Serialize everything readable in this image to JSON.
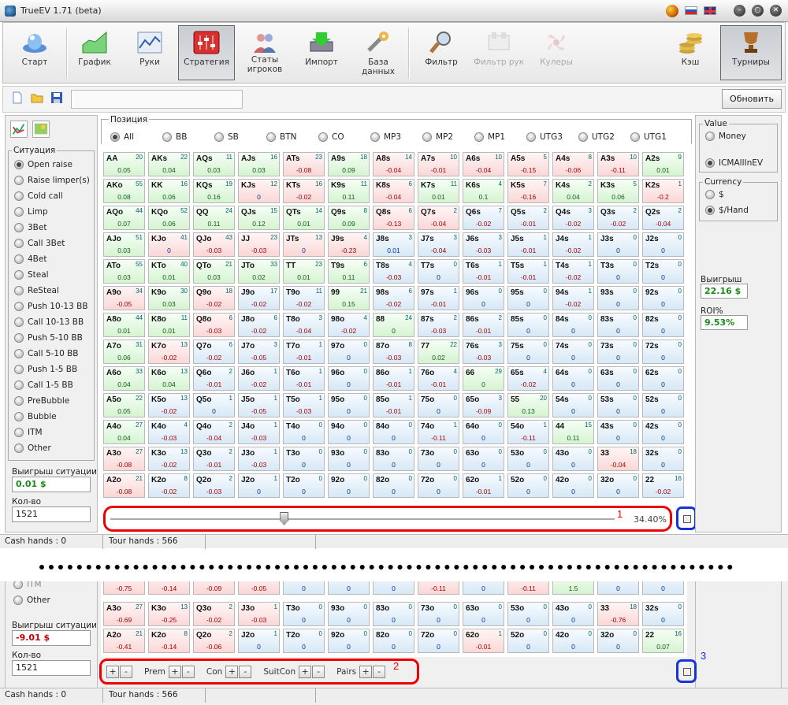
{
  "window": {
    "title": "TrueEV 1.71 (beta)"
  },
  "toolbar": {
    "items": [
      {
        "label": "Старт",
        "icon": "start-icon"
      },
      {
        "label": "График",
        "icon": "graph-icon"
      },
      {
        "label": "Руки",
        "icon": "hands-icon"
      },
      {
        "label": "Стратегия",
        "icon": "strategy-icon",
        "active": true
      },
      {
        "label": "Статы игроков",
        "icon": "players-stats-icon"
      },
      {
        "label": "Импорт",
        "icon": "import-icon"
      },
      {
        "label": "База данных",
        "icon": "database-icon"
      },
      {
        "label": "Фильтр",
        "icon": "filter-icon"
      },
      {
        "label": "Фильтр рук",
        "icon": "hand-filter-icon",
        "disabled": true
      },
      {
        "label": "Кулеры",
        "icon": "coolers-icon",
        "disabled": true
      },
      {
        "label": "Кэш",
        "icon": "cash-icon"
      },
      {
        "label": "Турниры",
        "icon": "tournaments-icon",
        "active": true
      }
    ],
    "update_label": "Обновить"
  },
  "position": {
    "legend": "Позиция",
    "options": [
      "All",
      "BB",
      "SB",
      "BTN",
      "CO",
      "MP3",
      "MP2",
      "MP1",
      "UTG3",
      "UTG2",
      "UTG1"
    ],
    "selected": "All"
  },
  "situation": {
    "legend": "Ситуация",
    "options": [
      "Open raise",
      "Raise limper(s)",
      "Cold call",
      "Limp",
      "3Bet",
      "Call 3Bet",
      "4Bet",
      "Steal",
      "ReSteal",
      "Push 10-13 BB",
      "Call 10-13 BB",
      "Push 5-10 BB",
      "Call 5-10 BB",
      "Push 1-5 BB",
      "Call 1-5 BB",
      "PreBubble",
      "Bubble",
      "ITM",
      "Other"
    ],
    "selected": "Open raise",
    "win_label": "Выигрыш ситуации",
    "win_value": "0.01 $",
    "count_label": "Кол-во",
    "count_value": "1521"
  },
  "value": {
    "legend": "Value",
    "options": [
      "Money",
      "ICMAllInEV"
    ],
    "selected": "ICMAllInEV"
  },
  "currency": {
    "legend": "Currency",
    "options": [
      "$",
      "$/Hand"
    ],
    "selected": "$/Hand"
  },
  "stats": {
    "win_label": "Выигрыш",
    "win_value": "22.16 $",
    "roi_label": "ROI%",
    "roi_value": "9.53%"
  },
  "slider": {
    "percent_label": "34.40%",
    "value_percent": 34.4
  },
  "status": {
    "cash": "Cash hands : 0",
    "tour": "Tour hands : 566"
  },
  "annotations": {
    "one": "1",
    "two": "2",
    "three": "3"
  },
  "bottom": {
    "win_value": "-9.01 $",
    "win_label": "Выигрыш ситуации",
    "count_label": "Кол-во",
    "count_value": "1521",
    "other_label": "Other",
    "itm_label": "ITM",
    "status_cash": "Cash hands : 0",
    "status_tour": "Tour hands : 566",
    "filters": [
      {
        "label": "Prem"
      },
      {
        "label": "Con"
      },
      {
        "label": "SuitCon"
      },
      {
        "label": "Pairs"
      }
    ],
    "plus": "+",
    "minus": "-",
    "top_values": [
      "-0.75",
      "-0.14",
      "-0.09",
      "-0.05",
      "0",
      "0",
      "0",
      "-0.11",
      "0",
      "-0.11",
      "1.5",
      "0",
      "0"
    ],
    "rows": [
      [
        [
          "A3o",
          "27",
          "-0.69",
          "r"
        ],
        [
          "K3o",
          "13",
          "-0.25",
          "r"
        ],
        [
          "Q3o",
          "2",
          "-0.02",
          "r"
        ],
        [
          "J3o",
          "1",
          "-0.03",
          "r"
        ],
        [
          "T3o",
          "0",
          "0",
          "b"
        ],
        [
          "93o",
          "0",
          "0",
          "b"
        ],
        [
          "83o",
          "0",
          "0",
          "b"
        ],
        [
          "73o",
          "0",
          "0",
          "b"
        ],
        [
          "63o",
          "0",
          "0",
          "b"
        ],
        [
          "53o",
          "0",
          "0",
          "b"
        ],
        [
          "43o",
          "0",
          "0",
          "b"
        ],
        [
          "33",
          "18",
          "-0.76",
          "r"
        ],
        [
          "32s",
          "0",
          "0",
          "b"
        ]
      ],
      [
        [
          "A2o",
          "21",
          "-0.41",
          "r"
        ],
        [
          "K2o",
          "8",
          "-0.14",
          "r"
        ],
        [
          "Q2o",
          "2",
          "-0.06",
          "r"
        ],
        [
          "J2o",
          "1",
          "0",
          "b"
        ],
        [
          "T2o",
          "0",
          "0",
          "b"
        ],
        [
          "92o",
          "0",
          "0",
          "b"
        ],
        [
          "82o",
          "0",
          "0",
          "b"
        ],
        [
          "72o",
          "0",
          "0",
          "b"
        ],
        [
          "62o",
          "1",
          "-0.01",
          "r"
        ],
        [
          "52o",
          "0",
          "0",
          "b"
        ],
        [
          "42o",
          "0",
          "0",
          "b"
        ],
        [
          "32o",
          "0",
          "0",
          "b"
        ],
        [
          "22",
          "16",
          "0.07",
          "g"
        ]
      ]
    ]
  },
  "grid": [
    [
      [
        "AA",
        "20",
        "0.05",
        "g"
      ],
      [
        "AKs",
        "22",
        "0.04",
        "g"
      ],
      [
        "AQs",
        "11",
        "0.03",
        "g"
      ],
      [
        "AJs",
        "16",
        "0.03",
        "g"
      ],
      [
        "ATs",
        "23",
        "-0.08",
        "r"
      ],
      [
        "A9s",
        "18",
        "0.09",
        "g"
      ],
      [
        "A8s",
        "14",
        "-0.04",
        "r"
      ],
      [
        "A7s",
        "10",
        "-0.01",
        "r"
      ],
      [
        "A6s",
        "10",
        "-0.04",
        "r"
      ],
      [
        "A5s",
        "5",
        "-0.15",
        "r"
      ],
      [
        "A4s",
        "8",
        "-0.06",
        "r"
      ],
      [
        "A3s",
        "10",
        "-0.11",
        "r"
      ],
      [
        "A2s",
        "9",
        "0.01",
        "g"
      ]
    ],
    [
      [
        "AKo",
        "55",
        "0.08",
        "g"
      ],
      [
        "KK",
        "16",
        "0.06",
        "g"
      ],
      [
        "KQs",
        "19",
        "0.16",
        "g"
      ],
      [
        "KJs",
        "12",
        "0",
        "r"
      ],
      [
        "KTs",
        "16",
        "-0.02",
        "r"
      ],
      [
        "K9s",
        "11",
        "0.11",
        "g"
      ],
      [
        "K8s",
        "6",
        "-0.04",
        "r"
      ],
      [
        "K7s",
        "11",
        "0.01",
        "g"
      ],
      [
        "K6s",
        "4",
        "0.1",
        "g"
      ],
      [
        "K5s",
        "7",
        "-0.16",
        "r"
      ],
      [
        "K4s",
        "2",
        "0.04",
        "g"
      ],
      [
        "K3s",
        "5",
        "0.06",
        "g"
      ],
      [
        "K2s",
        "1",
        "-0.2",
        "r"
      ]
    ],
    [
      [
        "AQo",
        "44",
        "0.07",
        "g"
      ],
      [
        "KQo",
        "52",
        "0.06",
        "g"
      ],
      [
        "QQ",
        "24",
        "0.11",
        "g"
      ],
      [
        "QJs",
        "15",
        "0.12",
        "g"
      ],
      [
        "QTs",
        "14",
        "0.01",
        "g"
      ],
      [
        "Q9s",
        "8",
        "0.09",
        "g"
      ],
      [
        "Q8s",
        "6",
        "-0.13",
        "r"
      ],
      [
        "Q7s",
        "2",
        "-0.04",
        "r"
      ],
      [
        "Q6s",
        "7",
        "-0.02",
        "b"
      ],
      [
        "Q5s",
        "2",
        "-0.01",
        "b"
      ],
      [
        "Q4s",
        "3",
        "-0.02",
        "b"
      ],
      [
        "Q3s",
        "2",
        "-0.02",
        "b"
      ],
      [
        "Q2s",
        "2",
        "-0.04",
        "b"
      ]
    ],
    [
      [
        "AJo",
        "51",
        "0.03",
        "g"
      ],
      [
        "KJo",
        "41",
        "0",
        "r"
      ],
      [
        "QJo",
        "43",
        "-0.03",
        "r"
      ],
      [
        "JJ",
        "23",
        "-0.03",
        "r"
      ],
      [
        "JTs",
        "13",
        "0",
        "r"
      ],
      [
        "J9s",
        "4",
        "-0.23",
        "r"
      ],
      [
        "J8s",
        "3",
        "0.01",
        "b"
      ],
      [
        "J7s",
        "3",
        "-0.04",
        "b"
      ],
      [
        "J6s",
        "3",
        "-0.03",
        "b"
      ],
      [
        "J5s",
        "1",
        "-0.01",
        "b"
      ],
      [
        "J4s",
        "1",
        "-0.02",
        "b"
      ],
      [
        "J3s",
        "0",
        "0",
        "b"
      ],
      [
        "J2s",
        "0",
        "0",
        "b"
      ]
    ],
    [
      [
        "ATo",
        "55",
        "0.03",
        "g"
      ],
      [
        "KTo",
        "40",
        "0.01",
        "g"
      ],
      [
        "QTo",
        "21",
        "0.03",
        "g"
      ],
      [
        "JTo",
        "33",
        "0.02",
        "g"
      ],
      [
        "TT",
        "23",
        "0.01",
        "g"
      ],
      [
        "T9s",
        "6",
        "0.11",
        "g"
      ],
      [
        "T8s",
        "4",
        "-0.03",
        "b"
      ],
      [
        "T7s",
        "0",
        "0",
        "b"
      ],
      [
        "T6s",
        "1",
        "-0.01",
        "b"
      ],
      [
        "T5s",
        "1",
        "-0.01",
        "b"
      ],
      [
        "T4s",
        "1",
        "-0.02",
        "b"
      ],
      [
        "T3s",
        "0",
        "0",
        "b"
      ],
      [
        "T2s",
        "0",
        "0",
        "b"
      ]
    ],
    [
      [
        "A9o",
        "34",
        "-0.05",
        "r"
      ],
      [
        "K9o",
        "30",
        "0.03",
        "g"
      ],
      [
        "Q9o",
        "18",
        "-0.02",
        "r"
      ],
      [
        "J9o",
        "17",
        "-0.02",
        "b"
      ],
      [
        "T9o",
        "11",
        "-0.02",
        "b"
      ],
      [
        "99",
        "21",
        "0.15",
        "g"
      ],
      [
        "98s",
        "6",
        "-0.02",
        "b"
      ],
      [
        "97s",
        "1",
        "-0.01",
        "b"
      ],
      [
        "96s",
        "0",
        "0",
        "b"
      ],
      [
        "95s",
        "0",
        "0",
        "b"
      ],
      [
        "94s",
        "1",
        "-0.02",
        "b"
      ],
      [
        "93s",
        "0",
        "0",
        "b"
      ],
      [
        "92s",
        "0",
        "0",
        "b"
      ]
    ],
    [
      [
        "A8o",
        "44",
        "0.01",
        "g"
      ],
      [
        "K8o",
        "11",
        "0.01",
        "g"
      ],
      [
        "Q8o",
        "6",
        "-0.03",
        "r"
      ],
      [
        "J8o",
        "6",
        "-0.02",
        "b"
      ],
      [
        "T8o",
        "3",
        "-0.04",
        "b"
      ],
      [
        "98o",
        "4",
        "-0.02",
        "b"
      ],
      [
        "88",
        "24",
        "0",
        "g"
      ],
      [
        "87s",
        "2",
        "-0.03",
        "b"
      ],
      [
        "86s",
        "2",
        "-0.01",
        "b"
      ],
      [
        "85s",
        "0",
        "0",
        "b"
      ],
      [
        "84s",
        "0",
        "0",
        "b"
      ],
      [
        "83s",
        "0",
        "0",
        "b"
      ],
      [
        "82s",
        "0",
        "0",
        "b"
      ]
    ],
    [
      [
        "A7o",
        "31",
        "0.06",
        "g"
      ],
      [
        "K7o",
        "13",
        "-0.02",
        "r"
      ],
      [
        "Q7o",
        "6",
        "-0.02",
        "b"
      ],
      [
        "J7o",
        "3",
        "-0.05",
        "b"
      ],
      [
        "T7o",
        "1",
        "-0.01",
        "b"
      ],
      [
        "97o",
        "0",
        "0",
        "b"
      ],
      [
        "87o",
        "8",
        "-0.03",
        "b"
      ],
      [
        "77",
        "22",
        "0.02",
        "g"
      ],
      [
        "76s",
        "3",
        "-0.03",
        "b"
      ],
      [
        "75s",
        "0",
        "0",
        "b"
      ],
      [
        "74s",
        "0",
        "0",
        "b"
      ],
      [
        "73s",
        "0",
        "0",
        "b"
      ],
      [
        "72s",
        "0",
        "0",
        "b"
      ]
    ],
    [
      [
        "A6o",
        "33",
        "0.04",
        "g"
      ],
      [
        "K6o",
        "13",
        "0.04",
        "g"
      ],
      [
        "Q6o",
        "2",
        "-0.01",
        "b"
      ],
      [
        "J6o",
        "1",
        "-0.02",
        "b"
      ],
      [
        "T6o",
        "1",
        "-0.01",
        "b"
      ],
      [
        "96o",
        "0",
        "0",
        "b"
      ],
      [
        "86o",
        "1",
        "-0.01",
        "b"
      ],
      [
        "76o",
        "4",
        "-0.01",
        "b"
      ],
      [
        "66",
        "29",
        "0",
        "g"
      ],
      [
        "65s",
        "4",
        "-0.02",
        "b"
      ],
      [
        "64s",
        "0",
        "0",
        "b"
      ],
      [
        "63s",
        "0",
        "0",
        "b"
      ],
      [
        "62s",
        "0",
        "0",
        "b"
      ]
    ],
    [
      [
        "A5o",
        "22",
        "0.05",
        "g"
      ],
      [
        "K5o",
        "13",
        "-0.02",
        "b"
      ],
      [
        "Q5o",
        "1",
        "0",
        "b"
      ],
      [
        "J5o",
        "1",
        "-0.05",
        "b"
      ],
      [
        "T5o",
        "1",
        "-0.03",
        "b"
      ],
      [
        "95o",
        "0",
        "0",
        "b"
      ],
      [
        "85o",
        "1",
        "-0.01",
        "b"
      ],
      [
        "75o",
        "0",
        "0",
        "b"
      ],
      [
        "65o",
        "3",
        "-0.09",
        "b"
      ],
      [
        "55",
        "20",
        "0.13",
        "g"
      ],
      [
        "54s",
        "0",
        "0",
        "b"
      ],
      [
        "53s",
        "0",
        "0",
        "b"
      ],
      [
        "52s",
        "0",
        "0",
        "b"
      ]
    ],
    [
      [
        "A4o",
        "27",
        "0.04",
        "g"
      ],
      [
        "K4o",
        "4",
        "-0.03",
        "b"
      ],
      [
        "Q4o",
        "2",
        "-0.04",
        "b"
      ],
      [
        "J4o",
        "1",
        "-0.03",
        "b"
      ],
      [
        "T4o",
        "0",
        "0",
        "b"
      ],
      [
        "94o",
        "0",
        "0",
        "b"
      ],
      [
        "84o",
        "0",
        "0",
        "b"
      ],
      [
        "74o",
        "1",
        "-0.11",
        "b"
      ],
      [
        "64o",
        "0",
        "0",
        "b"
      ],
      [
        "54o",
        "1",
        "-0.11",
        "b"
      ],
      [
        "44",
        "15",
        "0.11",
        "g"
      ],
      [
        "43s",
        "0",
        "0",
        "b"
      ],
      [
        "42s",
        "0",
        "0",
        "b"
      ]
    ],
    [
      [
        "A3o",
        "27",
        "-0.08",
        "r"
      ],
      [
        "K3o",
        "13",
        "-0.02",
        "b"
      ],
      [
        "Q3o",
        "2",
        "-0.01",
        "b"
      ],
      [
        "J3o",
        "1",
        "-0.03",
        "b"
      ],
      [
        "T3o",
        "0",
        "0",
        "b"
      ],
      [
        "93o",
        "0",
        "0",
        "b"
      ],
      [
        "83o",
        "0",
        "0",
        "b"
      ],
      [
        "73o",
        "0",
        "0",
        "b"
      ],
      [
        "63o",
        "0",
        "0",
        "b"
      ],
      [
        "53o",
        "0",
        "0",
        "b"
      ],
      [
        "43o",
        "0",
        "0",
        "b"
      ],
      [
        "33",
        "18",
        "-0.04",
        "r"
      ],
      [
        "32s",
        "0",
        "0",
        "b"
      ]
    ],
    [
      [
        "A2o",
        "21",
        "-0.08",
        "r"
      ],
      [
        "K2o",
        "8",
        "-0.02",
        "b"
      ],
      [
        "Q2o",
        "2",
        "-0.03",
        "b"
      ],
      [
        "J2o",
        "1",
        "0",
        "b"
      ],
      [
        "T2o",
        "0",
        "0",
        "b"
      ],
      [
        "92o",
        "0",
        "0",
        "b"
      ],
      [
        "82o",
        "0",
        "0",
        "b"
      ],
      [
        "72o",
        "0",
        "0",
        "b"
      ],
      [
        "62o",
        "1",
        "-0.01",
        "b"
      ],
      [
        "52o",
        "0",
        "0",
        "b"
      ],
      [
        "42o",
        "0",
        "0",
        "b"
      ],
      [
        "32o",
        "0",
        "0",
        "b"
      ],
      [
        "22",
        "16",
        "-0.02",
        "b"
      ]
    ]
  ]
}
